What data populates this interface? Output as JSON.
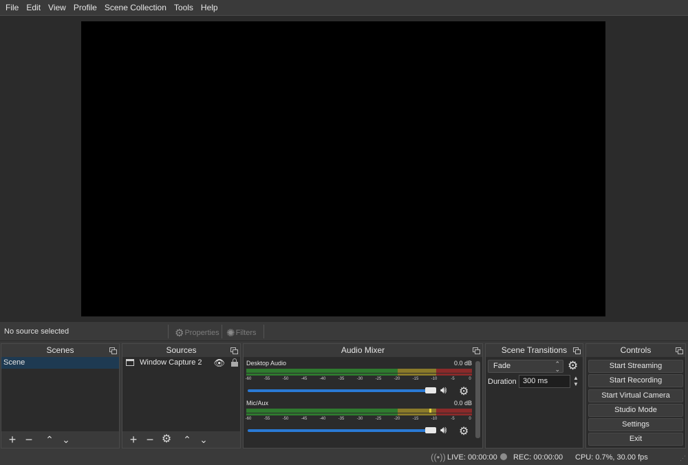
{
  "menu": [
    "File",
    "Edit",
    "View",
    "Profile",
    "Scene Collection",
    "Tools",
    "Help"
  ],
  "context": {
    "no_source": "No source selected",
    "properties": "Properties",
    "filters": "Filters"
  },
  "scenes": {
    "title": "Scenes",
    "items": [
      "Scene"
    ]
  },
  "sources": {
    "title": "Sources",
    "items": [
      "Window Capture 2"
    ]
  },
  "mixer": {
    "title": "Audio Mixer",
    "ticks": [
      "-60",
      "-55",
      "-50",
      "-45",
      "-40",
      "-35",
      "-30",
      "-25",
      "-20",
      "-15",
      "-10",
      "-5",
      "0"
    ],
    "channels": [
      {
        "name": "Desktop Audio",
        "level": "0.0 dB"
      },
      {
        "name": "Mic/Aux",
        "level": "0.0 dB"
      }
    ]
  },
  "transitions": {
    "title": "Scene Transitions",
    "selected": "Fade",
    "duration_label": "Duration",
    "duration_value": "300 ms"
  },
  "controls": {
    "title": "Controls",
    "buttons": [
      "Start Streaming",
      "Start Recording",
      "Start Virtual Camera",
      "Studio Mode",
      "Settings",
      "Exit"
    ]
  },
  "status": {
    "live": "LIVE: 00:00:00",
    "rec": "REC: 00:00:00",
    "cpu": "CPU: 0.7%, 30.00 fps"
  },
  "colors": {
    "background": "#3a3a3a",
    "panel": "#2b2b2b",
    "preview": "#000000",
    "selection": "#1e3a52",
    "fader": "#2a7ad5",
    "meter_green": "#2f7a2f",
    "meter_yellow": "#8a7a2a",
    "meter_red": "#8a2a2a"
  },
  "icons": {
    "properties": "gear-icon",
    "filters": "filter-icon",
    "visibility": "eye-icon",
    "lock": "lock-icon",
    "mute": "speaker-icon",
    "channel_settings": "gear-icon",
    "live": "broadcast-icon",
    "rec": "record-dot-icon"
  }
}
